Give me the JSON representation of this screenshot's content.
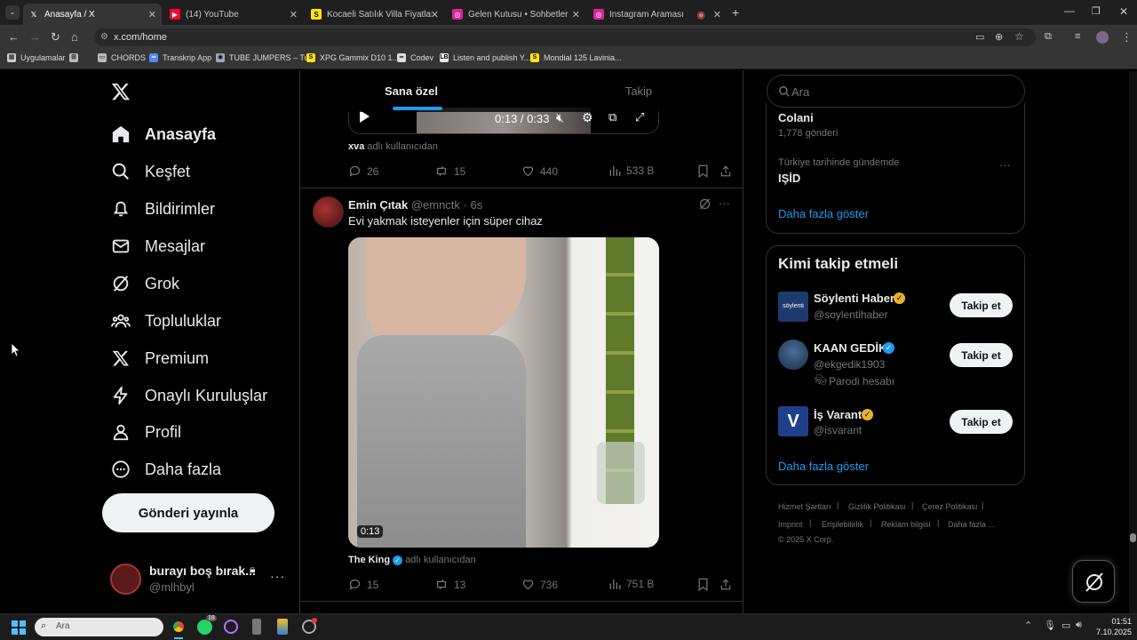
{
  "browser": {
    "tabs": [
      {
        "title": "Anasayfa / X",
        "active": true,
        "favicon": "x-icon"
      },
      {
        "title": "(14) YouTube",
        "active": false,
        "favicon": "youtube-icon"
      },
      {
        "title": "Kocaeli Satılık Villa Fiyatları ve",
        "active": false,
        "favicon": "sahibinden-icon"
      },
      {
        "title": "Gelen Kutusu • Sohbetler",
        "active": false,
        "favicon": "instagram-icon"
      },
      {
        "title": "Instagram Araması",
        "active": false,
        "favicon": "instagram-icon"
      }
    ],
    "url": "x.com/home",
    "bookmarks": [
      "Uygulamalar",
      "CHORDS",
      "Transkrip App",
      "TUBE JUMPERS – Tu...",
      "XPG Gammix D10 1...",
      "Codev",
      "Listen and publish Y...",
      "Mondial 125 Lavinia..."
    ]
  },
  "sidebar": {
    "items": [
      {
        "label": "Anasayfa",
        "icon": "home-icon"
      },
      {
        "label": "Keşfet",
        "icon": "search-icon"
      },
      {
        "label": "Bildirimler",
        "icon": "bell-icon"
      },
      {
        "label": "Mesajlar",
        "icon": "mail-icon"
      },
      {
        "label": "Grok",
        "icon": "grok-icon"
      },
      {
        "label": "Topluluklar",
        "icon": "communities-icon"
      },
      {
        "label": "Premium",
        "icon": "x-icon"
      },
      {
        "label": "Onaylı Kuruluşlar",
        "icon": "lightning-icon"
      },
      {
        "label": "Profil",
        "icon": "person-icon"
      },
      {
        "label": "Daha fazla",
        "icon": "more-circle-icon"
      }
    ],
    "post_button": "Gönderi yayınla",
    "account": {
      "name": "burayı boş bırak...",
      "handle": "@mlhbyl"
    }
  },
  "feed": {
    "tabs": [
      "Sana özel",
      "Takip"
    ],
    "prev_tweet": {
      "video_time": "0:13 / 0:33",
      "caption_user": "xva",
      "caption_suffix": "adlı kullanıcıdan",
      "replies": "26",
      "retweets": "15",
      "likes": "440",
      "views": "533 B"
    },
    "tweet": {
      "name": "Emin Çıtak",
      "handle": "@emnctk",
      "time": "· 6s",
      "text": "Evi yakmak isteyenler için süper cihaz",
      "video_duration": "0:13",
      "caption_user": "The King",
      "caption_suffix": "adlı kullanıcıdan",
      "replies": "15",
      "retweets": "13",
      "likes": "736",
      "views": "751 B"
    }
  },
  "right": {
    "search_placeholder": "Ara",
    "trends": [
      {
        "name": "Colani",
        "meta": "1,778 gönderi"
      },
      {
        "context": "Türkiye tarihinde gündemde",
        "name": "IŞİD"
      }
    ],
    "show_more": "Daha fazla göster",
    "who_to_follow_title": "Kimi takip etmeli",
    "suggestions": [
      {
        "name": "Söylenti Haber",
        "handle": "@soylentihaber",
        "badge": "gold",
        "avatar_text": "söylenti"
      },
      {
        "name": "KAAN GEDİK",
        "handle": "@ekgedik1903",
        "badge": "blue",
        "note": "Parodi hesabı"
      },
      {
        "name": "İş Varant",
        "handle": "@isvarant",
        "badge": "gold"
      }
    ],
    "follow_label": "Takip et",
    "footer": [
      "Hizmet Şartları",
      "Gizlilik Politikası",
      "Çerez Politikası",
      "Imprint",
      "Erişilebilirlik",
      "Reklam bilgisi",
      "Daha fazla ...",
      "© 2025 X Corp."
    ]
  },
  "taskbar": {
    "search_placeholder": "Ara",
    "time": "01:51",
    "date": "7.10.2025",
    "whatsapp_badge": "18"
  },
  "colors": {
    "accent": "#1d9bf0",
    "gold": "#e8b22a",
    "bg": "#000000",
    "muted": "#71767b"
  }
}
